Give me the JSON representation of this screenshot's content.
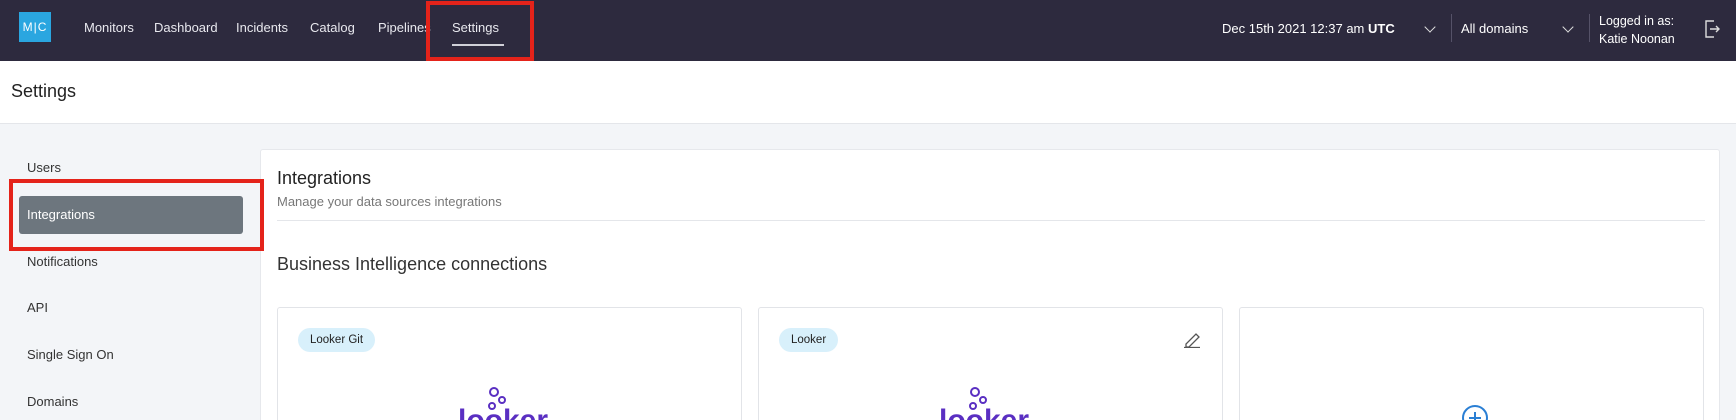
{
  "app": {
    "logo_text": "M|C"
  },
  "nav": {
    "items": [
      "Monitors",
      "Dashboard",
      "Incidents",
      "Catalog",
      "Pipelines",
      "Settings"
    ],
    "active": "Settings"
  },
  "header_right": {
    "date_prefix": "Dec 15th 2021 12:37 am ",
    "date_tz": "UTC",
    "domain_select": "All domains",
    "logged_in_label": "Logged in as:",
    "user_name": "Katie Noonan"
  },
  "page": {
    "title": "Settings"
  },
  "sidebar": {
    "items": [
      "Users",
      "Integrations",
      "Notifications",
      "API",
      "Single Sign On",
      "Domains"
    ],
    "active": "Integrations"
  },
  "main": {
    "title": "Integrations",
    "subtitle": "Manage your data sources integrations",
    "section_title": "Business Intelligence connections",
    "cards": [
      {
        "tag": "Looker Git",
        "logo": "Looker",
        "editable": false
      },
      {
        "tag": "Looker",
        "logo": "Looker",
        "editable": true
      },
      {
        "tag": "",
        "logo": "add",
        "editable": false
      }
    ]
  },
  "colors": {
    "topbar": "#2d2a3e",
    "accent_logo": "#2aa6e0",
    "highlight": "#e4231a",
    "looker_purple": "#5a2fc2",
    "active_sidebar": "#6d767e",
    "tag_bg": "#d8f0fb"
  },
  "icons": {
    "logout": "logout-icon",
    "edit": "pencil-icon",
    "add": "plus-circle-icon",
    "dropdown": "chevron-down-icon"
  }
}
